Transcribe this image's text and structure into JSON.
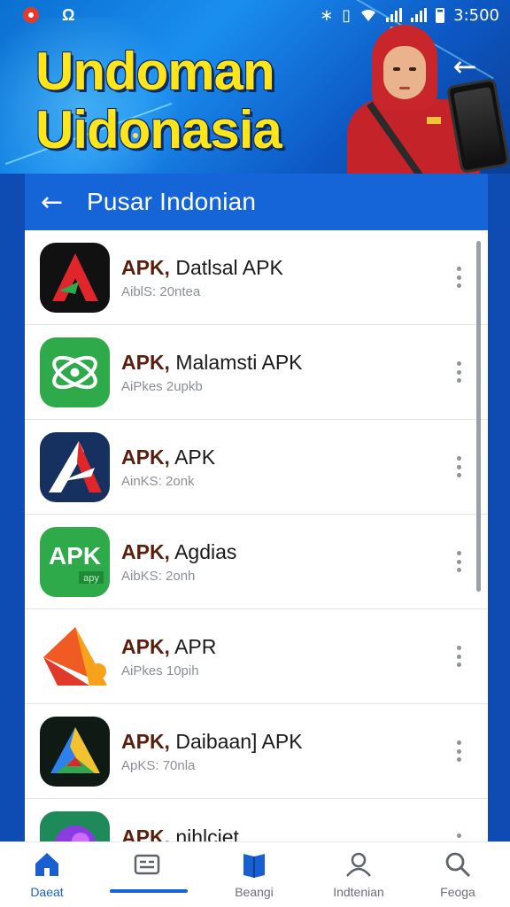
{
  "status_bar": {
    "carrier_icon": "g-icon",
    "carrier_label": "Ω",
    "time": "3:500"
  },
  "banner": {
    "headline_line1": "Undoman",
    "headline_line2": "Uidonasia"
  },
  "app_bar": {
    "title": "Pusar Indonian"
  },
  "apps": [
    {
      "prefix": "APK,",
      "name": "Datlsal APK",
      "meta": "AiblS:  20ntea",
      "icon": "red-a-logo-icon"
    },
    {
      "prefix": "APK,",
      "name": "Malamsti APK",
      "meta": "AiPkes  2upkb",
      "icon": "green-atom-logo-icon"
    },
    {
      "prefix": "APK,",
      "name": "APK",
      "meta": "AinKS:  2onk",
      "icon": "navy-a-logo-icon"
    },
    {
      "prefix": "APK,",
      "name": "Agdias",
      "meta": "AibKS:  2onh",
      "icon_text": "APK",
      "icon_subtext": "apy",
      "icon": "green-apk-logo-icon"
    },
    {
      "prefix": "APK,",
      "name": "APR",
      "meta": "AiPkes  10pih",
      "icon": "orange-triangle-logo-icon"
    },
    {
      "prefix": "APK,",
      "name": "Daibaan] APK",
      "meta": "ApKS:  70nla",
      "icon": "gradient-a-logo-icon"
    },
    {
      "prefix": "APK,",
      "name": "nihlciet",
      "meta": "",
      "icon": "purple-logo-icon"
    }
  ],
  "bottom_nav": [
    {
      "label": "Daeat",
      "icon": "home-icon",
      "active": true
    },
    {
      "label": "",
      "icon": "card-icon",
      "active": false
    },
    {
      "label": "Beangi",
      "icon": "book-icon",
      "active": false
    },
    {
      "label": "Indtenian",
      "icon": "user-icon",
      "active": false
    },
    {
      "label": "Feoga",
      "icon": "search-icon",
      "active": false
    }
  ],
  "colors": {
    "primary": "#1565d8",
    "headline": "#ffe51a",
    "apk_prefix": "#5a1e0c"
  }
}
